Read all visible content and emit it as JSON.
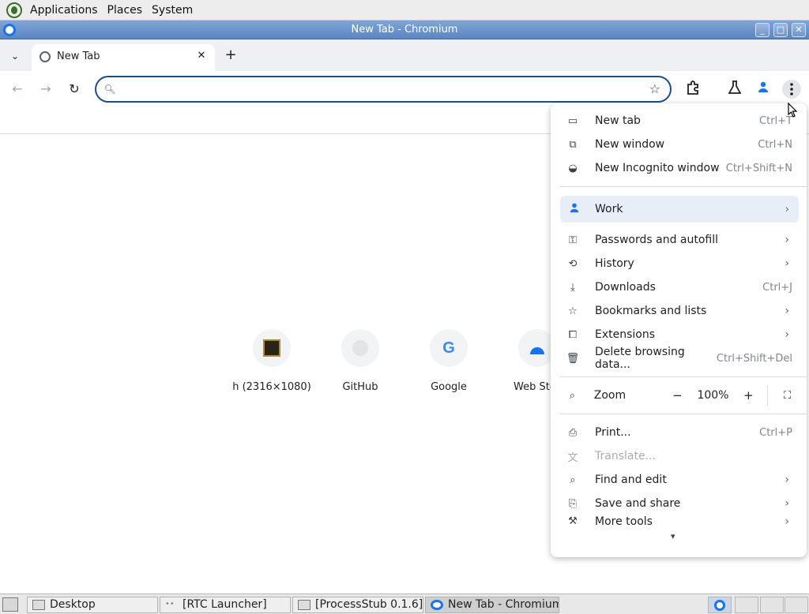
{
  "top_panel": {
    "menus": [
      "Applications",
      "Places",
      "System"
    ]
  },
  "window": {
    "title": "New Tab - Chromium",
    "minimize": "_",
    "maximize": "□",
    "close": "✕"
  },
  "tabs": {
    "active_label": "New Tab",
    "close": "✕",
    "new_tab": "+",
    "list": "⌄"
  },
  "toolbar": {
    "back": "←",
    "forward": "→",
    "reload": "↻",
    "omnibox_value": "",
    "omnibox_placeholder": ""
  },
  "shortcuts": [
    {
      "name": "h (2316×1080)"
    },
    {
      "name": "GitHub"
    },
    {
      "name": "Google"
    },
    {
      "name": "Web Sto"
    }
  ],
  "app_menu": {
    "new_tab": {
      "label": "New tab",
      "shortcut": "Ctrl+T"
    },
    "new_window": {
      "label": "New window",
      "shortcut": "Ctrl+N"
    },
    "new_incognito": {
      "label": "New Incognito window",
      "shortcut": "Ctrl+Shift+N"
    },
    "profile": {
      "label": "Work"
    },
    "passwords": {
      "label": "Passwords and autofill"
    },
    "history": {
      "label": "History"
    },
    "downloads": {
      "label": "Downloads",
      "shortcut": "Ctrl+J"
    },
    "bookmarks": {
      "label": "Bookmarks and lists"
    },
    "extensions": {
      "label": "Extensions"
    },
    "delete_data": {
      "label": "Delete browsing data...",
      "shortcut": "Ctrl+Shift+Del"
    },
    "zoom": {
      "label": "Zoom",
      "minus": "−",
      "value": "100%",
      "plus": "+"
    },
    "print": {
      "label": "Print...",
      "shortcut": "Ctrl+P"
    },
    "translate": {
      "label": "Translate..."
    },
    "find_edit": {
      "label": "Find and edit"
    },
    "save_share": {
      "label": "Save and share"
    },
    "more_tools": {
      "label": "More tools"
    },
    "scroll_down": "▾"
  },
  "taskbar": {
    "items": [
      {
        "label": "Desktop"
      },
      {
        "label": "[RTC Launcher]"
      },
      {
        "label": "[ProcessStub 0.1.6]"
      },
      {
        "label": "New Tab - Chromium"
      }
    ]
  },
  "colors": {
    "accent": "#1a73e8",
    "titlebar": "#6d93c9",
    "omnibox_border": "#1a4e8f"
  }
}
